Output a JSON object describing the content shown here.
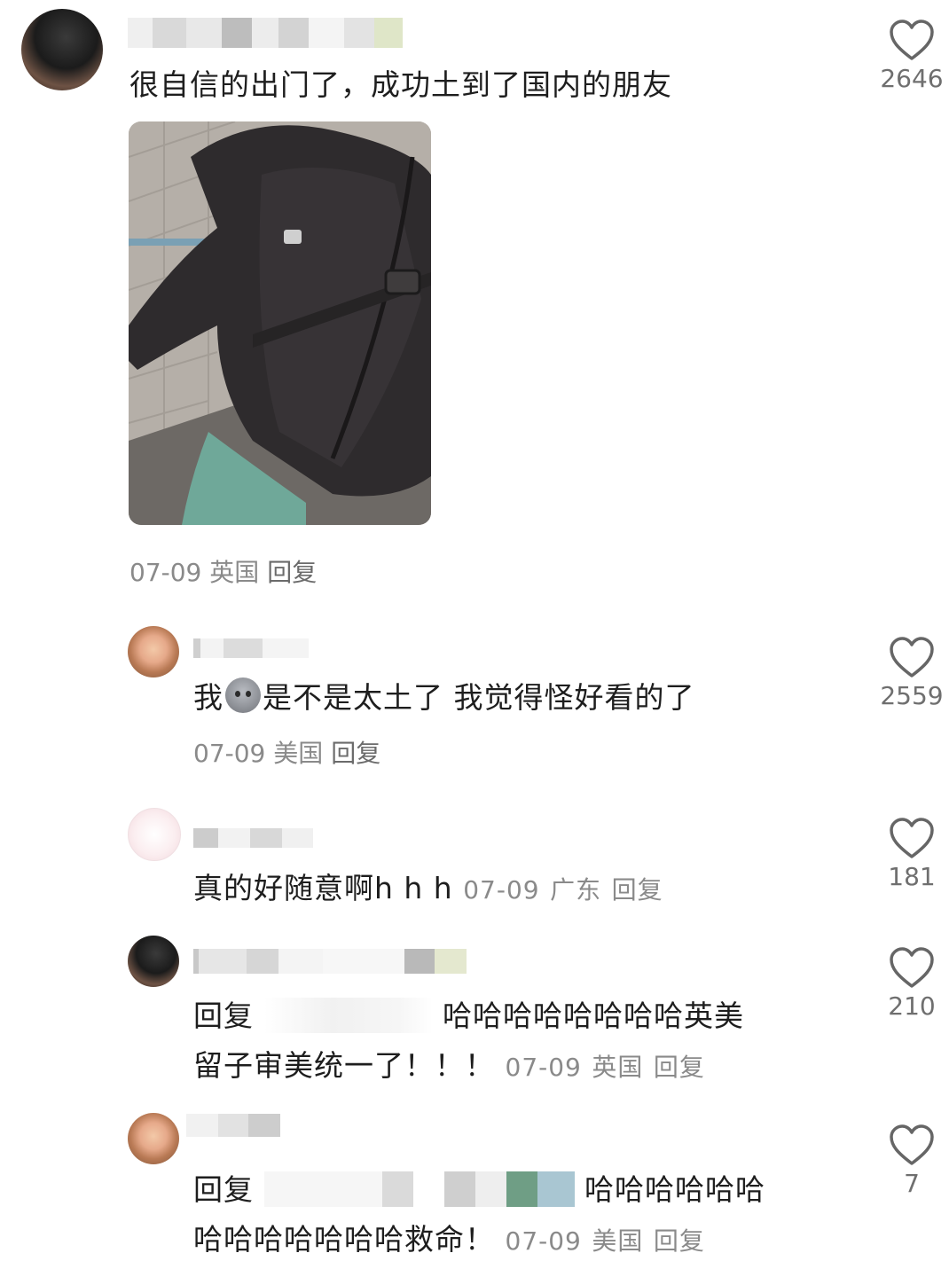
{
  "comments": [
    {
      "text": "很自信的出门了，成功土到了国内的朋友",
      "date": "07-09",
      "location": "英国",
      "reply_label": "回复",
      "likes": "2646"
    },
    {
      "text_before_emoji": "我",
      "emoji": "sad-face-emoji",
      "text_after_emoji": "是不是太土了 我觉得怪好看的了",
      "date": "07-09",
      "location": "美国",
      "reply_label": "回复",
      "likes": "2559"
    },
    {
      "text": "真的好随意啊h h h",
      "date": "07-09",
      "location": "广东",
      "reply_label": "回复",
      "likes": "181"
    },
    {
      "reply_prefix": "回复",
      "line1_text": "哈哈哈哈哈哈哈哈英美",
      "line2_text": "留子审美统一了！！！",
      "date": "07-09",
      "location": "英国",
      "reply_label": "回复",
      "likes": "210"
    },
    {
      "reply_prefix": "回复",
      "line1_text": "哈哈哈哈哈哈",
      "line2_text": "哈哈哈哈哈哈哈救命！",
      "date": "07-09",
      "location": "美国",
      "reply_label": "回复",
      "likes": "7"
    }
  ],
  "colors": {
    "text": "#1e1e1e",
    "meta": "#8a8a8a",
    "heart_stroke": "#666666",
    "redaction_green": "#6f9e85",
    "redaction_blue": "#a9c6d2"
  },
  "icons": [
    "heart-icon",
    "sad-face-emoji"
  ]
}
